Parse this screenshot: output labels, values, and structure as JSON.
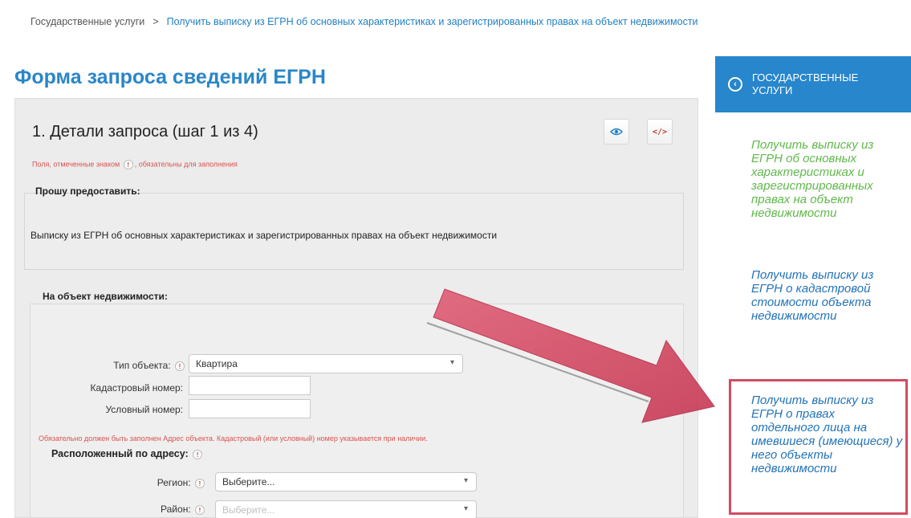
{
  "breadcrumb": {
    "root": "Государственные услуги",
    "separator": ">",
    "current": "Получить выписку из ЕГРН об основных характеристиках и зарегистрированных правах на объект недвижимости"
  },
  "page_title": "Форма запроса сведений ЕГРН",
  "step_title": "1. Детали запроса (шаг 1 из 4)",
  "required_note": {
    "before": "Поля, отмеченные знаком",
    "mark": "!",
    "after": ", обязательны для заполнения"
  },
  "request": {
    "label": "Прошу предоставить:",
    "value": "Выписку из ЕГРН об основных характеристиках и зарегистрированных правах на объект недвижимости"
  },
  "object": {
    "label": "На объект недвижимости:",
    "type_label": "Тип объекта:",
    "type_value": "Квартира",
    "cadastral_label": "Кадастровый номер:",
    "conditional_label": "Условный номер:"
  },
  "address": {
    "note": "Обязательно должен быть заполнен Адрес объекта. Кадастровый (или условный) номер указывается при наличии.",
    "label": "Расположенный по адресу:",
    "region_label": "Регион:",
    "region_placeholder": "Выберите...",
    "district_label": "Район:",
    "district_placeholder": "Выберите..."
  },
  "sidebar": {
    "header": "Государственные услуги",
    "links": [
      "Получить выписку из ЕГРН об основных характеристиках и зарегистрированных правах на объект недвижимости",
      "Получить выписку из ЕГРН о кадастровой стоимости объекта недвижимости",
      "Получить выписку из ЕГРН о правах отдельного лица на имевшиеся (имеющиеся) у него объекты недвижимости"
    ]
  },
  "icons": {
    "view": "eye-icon",
    "code": "code-icon",
    "back": "chevron-left-icon",
    "annotation": "red-arrow"
  },
  "colors": {
    "accent_blue": "#2786cc",
    "link_green": "#5fb84a",
    "required_red": "#d9534f",
    "annotation_red": "#d24b63"
  }
}
